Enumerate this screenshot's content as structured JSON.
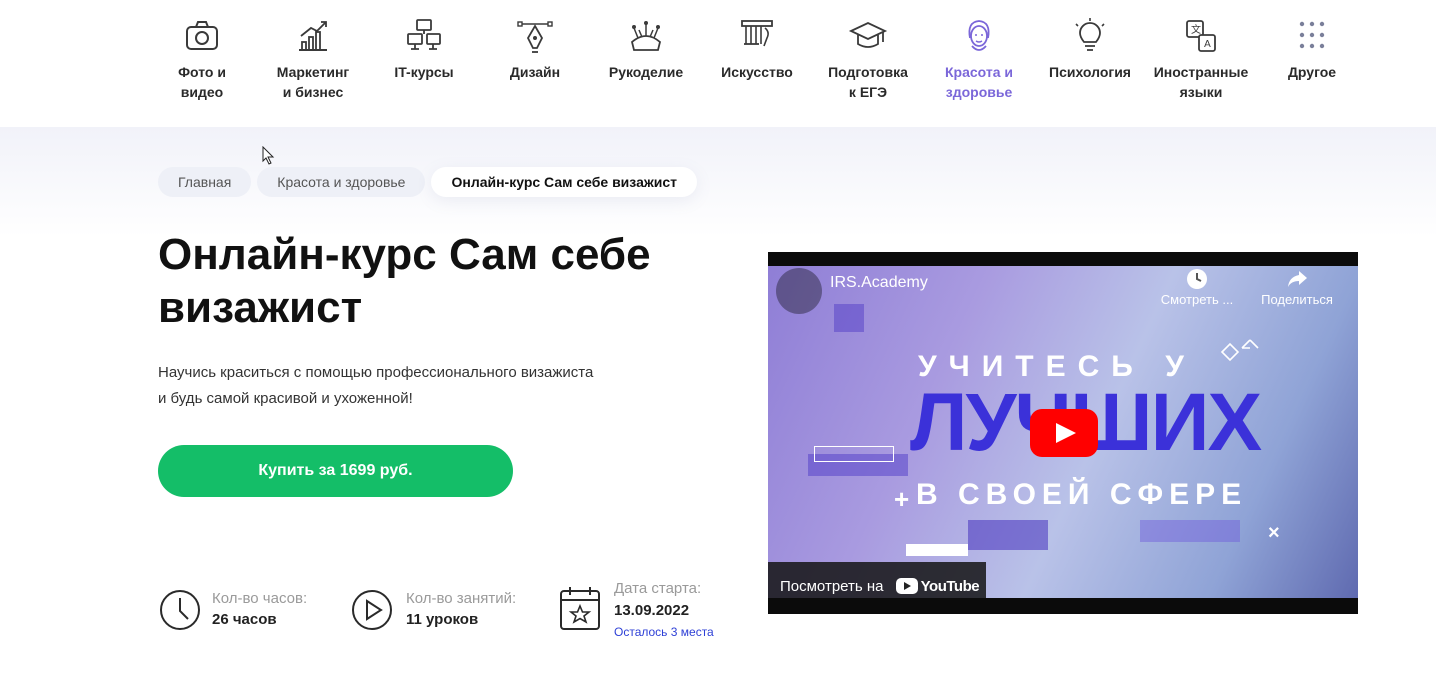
{
  "categories": [
    {
      "label": "Фото и\nвидео",
      "icon": "camera-icon"
    },
    {
      "label": "Маркетинг\nи бизнес",
      "icon": "chart-growth-icon"
    },
    {
      "label": "IT-курсы",
      "icon": "devices-icon"
    },
    {
      "label": "Дизайн",
      "icon": "pen-tool-icon"
    },
    {
      "label": "Рукоделие",
      "icon": "pincushion-icon"
    },
    {
      "label": "Искусство",
      "icon": "column-icon"
    },
    {
      "label": "Подготовка\nк ЕГЭ",
      "icon": "graduation-cap-icon"
    },
    {
      "label": "Красота и\nздоровье",
      "icon": "woman-face-icon",
      "active": true
    },
    {
      "label": "Психология",
      "icon": "lightbulb-icon"
    },
    {
      "label": "Иностранные\nязыки",
      "icon": "translate-icon"
    },
    {
      "label": "Другое",
      "icon": "grid-dots-icon"
    }
  ],
  "breadcrumbs": [
    "Главная",
    "Красота и здоровье",
    "Онлайн-курс Сам себе визажист"
  ],
  "course": {
    "title": "Онлайн-курс Сам себе визажист",
    "description_line1": "Научись краситься с помощью профессионального визажиста",
    "description_line2": "и будь самой красивой и ухоженной!",
    "buy_label": "Купить за 1699 руб."
  },
  "stats": {
    "hours_label": "Кол-во часов:",
    "hours_value": "26 часов",
    "lessons_label": "Кол-во занятий:",
    "lessons_value": "11 уроков",
    "start_label": "Дата старта:",
    "start_value": "13.09.2022",
    "seats_note": "Осталось 3 места"
  },
  "video": {
    "channel": "IRS.Academy",
    "watch_later": "Смотреть ...",
    "share": "Поделиться",
    "line1": "УЧИТЕСЬ У",
    "line2": "ЛУЧШИХ",
    "line3": "В СВОЕЙ СФЕРЕ",
    "watch_on": "Посмотреть на",
    "youtube": "YouTube"
  },
  "colors": {
    "accent_green": "#14be68",
    "active_category": "#7b67d9",
    "link_blue": "#2d3fd6"
  }
}
